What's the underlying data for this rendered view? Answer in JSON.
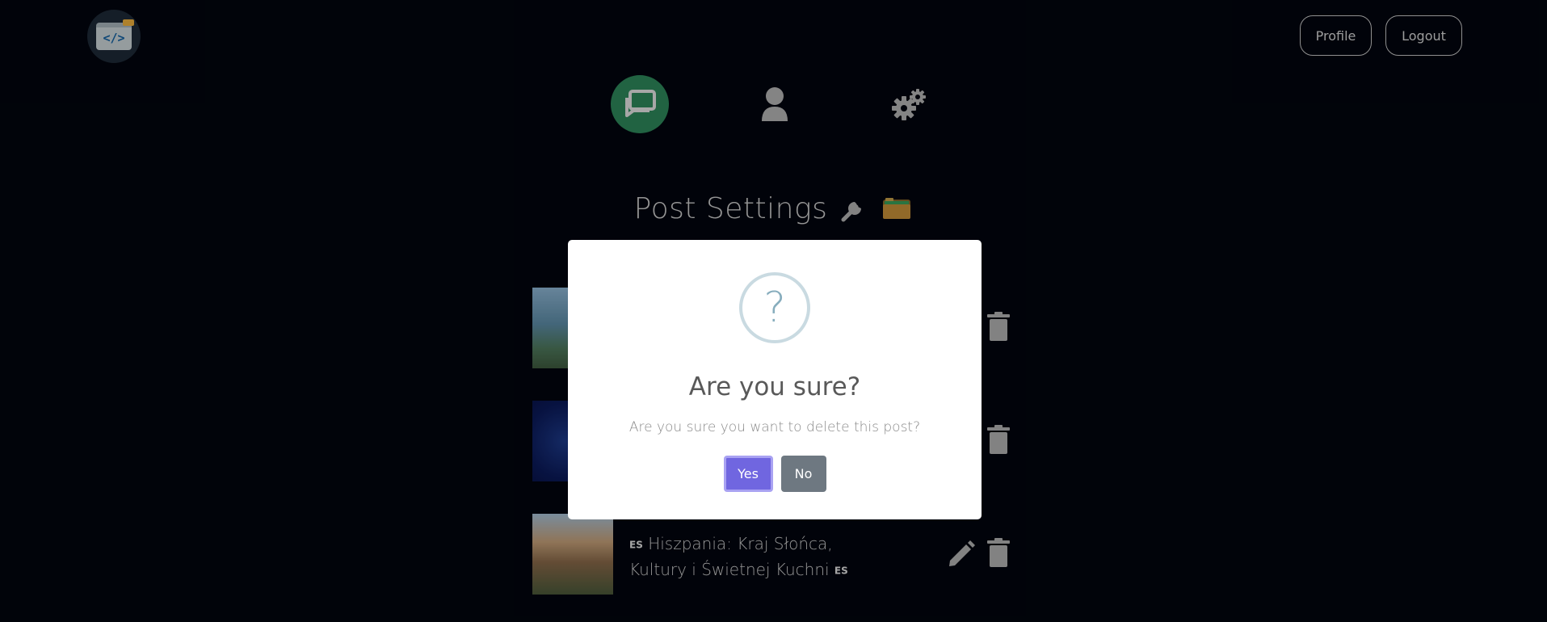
{
  "header": {
    "logo_text": "</>",
    "profile_label": "Profile",
    "logout_label": "Logout"
  },
  "nav": {
    "items": [
      {
        "icon": "posts-chat-icon",
        "active": true,
        "color": "#2f8a5c"
      },
      {
        "icon": "user-icon",
        "active": false
      },
      {
        "icon": "gears-icon",
        "active": false
      }
    ]
  },
  "page": {
    "title": "Post Settings"
  },
  "posts": [
    {
      "thumbnail": "statue-of-liberty-image",
      "title": "",
      "actions": [
        "trash-icon"
      ]
    },
    {
      "thumbnail": "tech-network-image",
      "title": "",
      "actions": [
        "trash-icon"
      ]
    },
    {
      "thumbnail": "spain-city-image",
      "lang_prefix": "ES",
      "title": "Hiszpania: Kraj Słońca, Kultury i Świetnej Kuchni",
      "lang_suffix": "ES",
      "actions": [
        "edit-icon",
        "trash-icon"
      ]
    }
  ],
  "modal": {
    "icon": "?",
    "title": "Are you sure?",
    "text": "Are you sure you want to delete this post?",
    "yes_label": "Yes",
    "no_label": "No",
    "yes_color": "#7066e0",
    "no_color": "#6e7881"
  }
}
